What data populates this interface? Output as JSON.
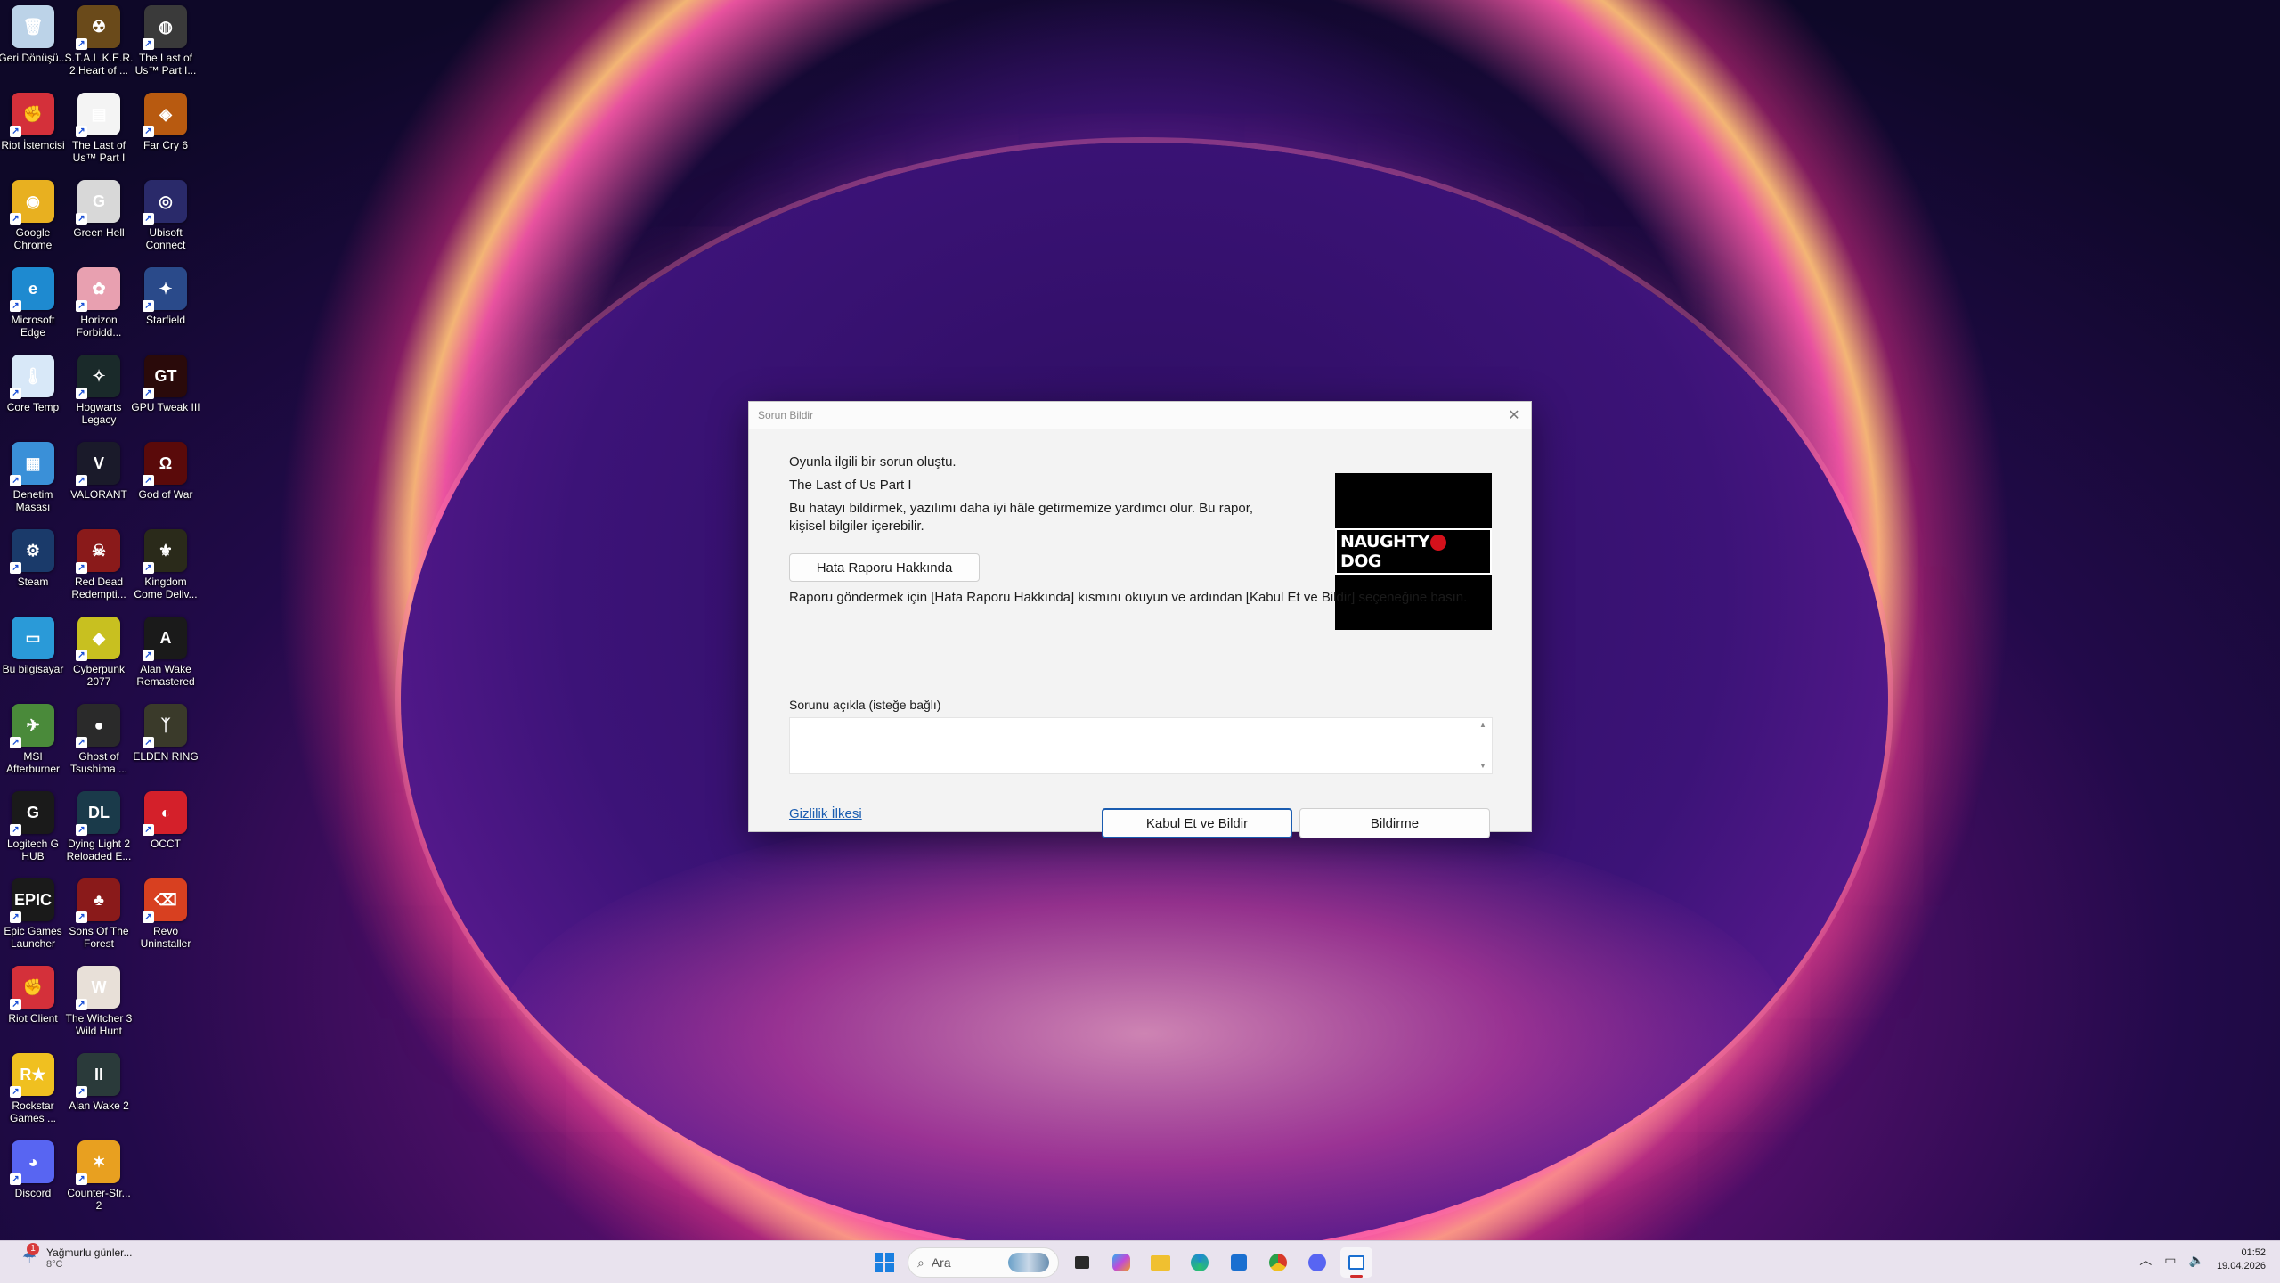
{
  "desktop_icons": [
    {
      "label": "Geri Dönüşü...",
      "color": "#bcd3e8",
      "glyph": "🗑",
      "shortcut": false
    },
    {
      "label": "S.T.A.L.K.E.R. 2 Heart of ...",
      "color": "#6a4a1a",
      "glyph": "☢",
      "shortcut": true
    },
    {
      "label": "The Last of Us™ Part I...",
      "color": "#3a3a3a",
      "glyph": "◍",
      "shortcut": true
    },
    {
      "label": "Riot İstemcisi",
      "color": "#d4303a",
      "glyph": "✊",
      "shortcut": true
    },
    {
      "label": "The Last of Us™ Part I",
      "color": "#f4f4f4",
      "glyph": "▤",
      "shortcut": true
    },
    {
      "label": "Far Cry 6",
      "color": "#b85a10",
      "glyph": "◈",
      "shortcut": true
    },
    {
      "label": "Google Chrome",
      "color": "#e8b020",
      "glyph": "◉",
      "shortcut": true
    },
    {
      "label": "Green Hell",
      "color": "#d8d8d8",
      "glyph": "G",
      "shortcut": true
    },
    {
      "label": "Ubisoft Connect",
      "color": "#2a2a6a",
      "glyph": "◎",
      "shortcut": true
    },
    {
      "label": "Microsoft Edge",
      "color": "#1e8ad0",
      "glyph": "e",
      "shortcut": true
    },
    {
      "label": "Horizon Forbidd...",
      "color": "#e8a0b0",
      "glyph": "✿",
      "shortcut": true
    },
    {
      "label": "Starfield",
      "color": "#2a4a8a",
      "glyph": "✦",
      "shortcut": true
    },
    {
      "label": "Core Temp",
      "color": "#d8e8f8",
      "glyph": "🌡",
      "shortcut": true
    },
    {
      "label": "Hogwarts Legacy",
      "color": "#1a2a2a",
      "glyph": "✧",
      "shortcut": true
    },
    {
      "label": "GPU Tweak III",
      "color": "#2a0a0a",
      "glyph": "GT",
      "shortcut": true
    },
    {
      "label": "Denetim Masası",
      "color": "#3a90d8",
      "glyph": "▦",
      "shortcut": true
    },
    {
      "label": "VALORANT",
      "color": "#1a1a2a",
      "glyph": "V",
      "shortcut": true
    },
    {
      "label": "God of War",
      "color": "#5a0a0a",
      "glyph": "Ω",
      "shortcut": true
    },
    {
      "label": "Steam",
      "color": "#1a3a6a",
      "glyph": "⚙",
      "shortcut": true
    },
    {
      "label": "Red Dead Redempti...",
      "color": "#8a1a1a",
      "glyph": "☠",
      "shortcut": true
    },
    {
      "label": "Kingdom Come Deliv...",
      "color": "#2a2a1a",
      "glyph": "⚜",
      "shortcut": true
    },
    {
      "label": "Bu bilgisayar",
      "color": "#2a9ad8",
      "glyph": "▭",
      "shortcut": false
    },
    {
      "label": "Cyberpunk 2077",
      "color": "#c8c020",
      "glyph": "◆",
      "shortcut": true
    },
    {
      "label": "Alan Wake Remastered",
      "color": "#1a1a1a",
      "glyph": "A",
      "shortcut": true
    },
    {
      "label": "MSI Afterburner",
      "color": "#4a8a3a",
      "glyph": "✈",
      "shortcut": true
    },
    {
      "label": "Ghost of Tsushima ...",
      "color": "#2a2a2a",
      "glyph": "●",
      "shortcut": true
    },
    {
      "label": "ELDEN RING",
      "color": "#3a3a2a",
      "glyph": "ᛉ",
      "shortcut": true
    },
    {
      "label": "Logitech G HUB",
      "color": "#1a1a1a",
      "glyph": "G",
      "shortcut": true
    },
    {
      "label": "Dying Light 2 Reloaded E...",
      "color": "#1a3a4a",
      "glyph": "DL",
      "shortcut": true
    },
    {
      "label": "OCCT",
      "color": "#d4202a",
      "glyph": "◐",
      "shortcut": true
    },
    {
      "label": "Epic Games Launcher",
      "color": "#1a1a1a",
      "glyph": "EPIC",
      "shortcut": true
    },
    {
      "label": "Sons Of The Forest",
      "color": "#8a1a1a",
      "glyph": "♣",
      "shortcut": true
    },
    {
      "label": "Revo Uninstaller",
      "color": "#d84020",
      "glyph": "⌫",
      "shortcut": true
    },
    {
      "label": "Riot Client",
      "color": "#d4303a",
      "glyph": "✊",
      "shortcut": true
    },
    {
      "label": "The Witcher 3 Wild Hunt",
      "color": "#e8e0d8",
      "glyph": "W",
      "shortcut": true
    },
    null,
    {
      "label": "Rockstar Games ...",
      "color": "#f0c020",
      "glyph": "R★",
      "shortcut": true
    },
    {
      "label": "Alan Wake 2",
      "color": "#2a3a3a",
      "glyph": "II",
      "shortcut": true
    },
    null,
    {
      "label": "Discord",
      "color": "#5865f2",
      "glyph": "◕",
      "shortcut": true
    },
    {
      "label": "Counter-Str... 2",
      "color": "#e8a020",
      "glyph": "✶",
      "shortcut": true
    },
    null
  ],
  "dialog": {
    "title": "Sorun Bildir",
    "close_glyph": "✕",
    "heading": "Oyunla ilgili bir sorun oluştu.",
    "game_name": "The Last of Us Part I",
    "description": "Bu hatayı bildirmek, yazılımı daha iyi hâle getirmemize yardımcı olur. Bu rapor, kişisel bilgiler içerebilir.",
    "about_button": "Hata Raporu Hakkında",
    "instruction": "Raporu göndermek için [Hata Raporu Hakkında] kısmını okuyun ve ardından [Kabul Et ve Bildir] seçeneğine basın.",
    "describe_label": "Sorunu açıkla (isteğe bağlı)",
    "describe_value": "",
    "privacy_link": "Gizlilik İlkesi",
    "accept_button": "Kabul Et ve Bildir",
    "decline_button": "Bildirme",
    "logo_left": "NAUGHTY",
    "logo_right": "DOG"
  },
  "taskbar": {
    "weather_title": "Yağmurlu günler...",
    "weather_temp": "8°C",
    "weather_badge": "1",
    "search_placeholder": "Ara",
    "time": "01:52",
    "date": "19.04.2026",
    "accent_color": "#d02a2a"
  }
}
